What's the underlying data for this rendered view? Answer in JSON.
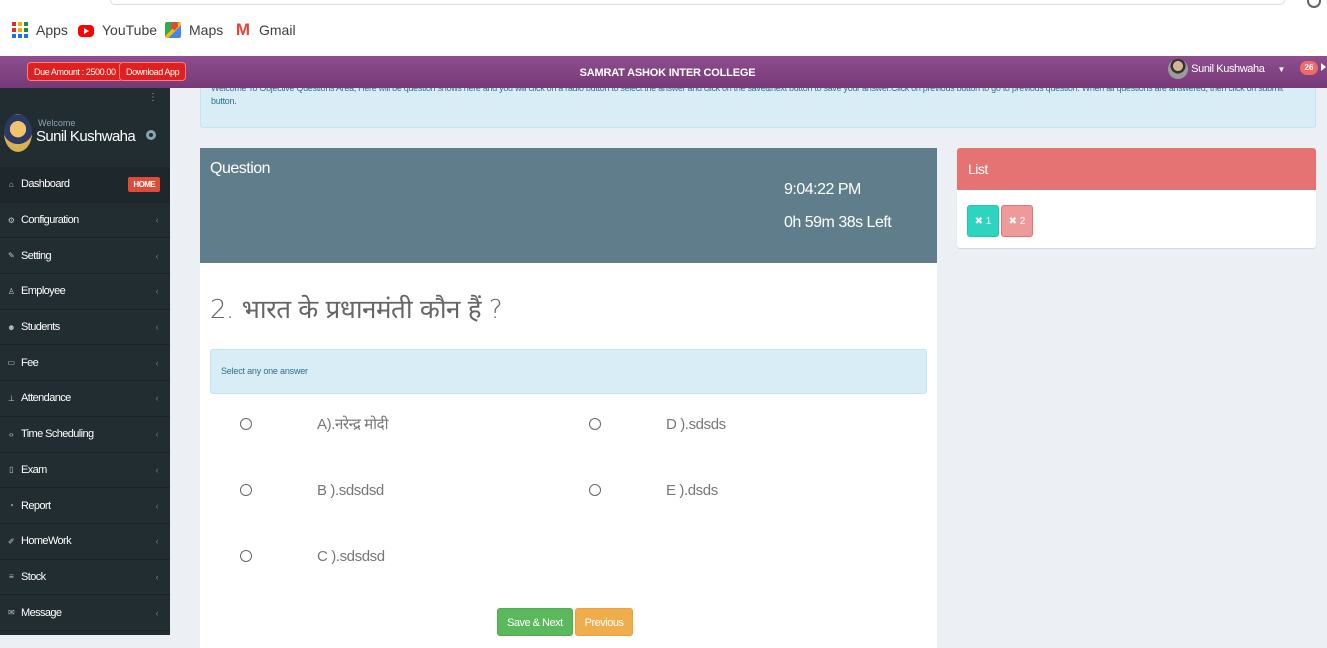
{
  "bookmarks": [
    {
      "label": "Apps",
      "icon": "apps-grid-icon"
    },
    {
      "label": "YouTube",
      "icon": "youtube-icon"
    },
    {
      "label": "Maps",
      "icon": "maps-icon"
    },
    {
      "label": "Gmail",
      "icon": "gmail-icon"
    }
  ],
  "header": {
    "due_amount": "Due Amount : 2500.00",
    "download_app": "Download App",
    "college_name": "SAMRAT ASHOK INTER COLLEGE",
    "user_name": "Sunil Kushwaha",
    "notification_count": "26",
    "brand_color": "#7d417e"
  },
  "sidebar": {
    "welcome": "Welcome",
    "user_name": "Sunil Kushwaha",
    "home_badge": "HOME",
    "items": [
      {
        "label": "Dashboard",
        "icon": "home-icon"
      },
      {
        "label": "Configuration",
        "icon": "cogs-icon"
      },
      {
        "label": "Setting",
        "icon": "wrench-icon"
      },
      {
        "label": "Employee",
        "icon": "user-icon"
      },
      {
        "label": "Students",
        "icon": "users-icon"
      },
      {
        "label": "Fee",
        "icon": "money-icon"
      },
      {
        "label": "Attendance",
        "icon": "sitemap-icon"
      },
      {
        "label": "Time Scheduling",
        "icon": "code-icon"
      },
      {
        "label": "Exam",
        "icon": "file-icon"
      },
      {
        "label": "Report",
        "icon": "report-icon"
      },
      {
        "label": "HomeWork",
        "icon": "pencil-icon"
      },
      {
        "label": "Stock",
        "icon": "list-icon"
      },
      {
        "label": "Message",
        "icon": "envelope-icon"
      }
    ]
  },
  "notice": {
    "text": "Welcome To Objective Questions Area, Here will be question shows here and you will click on a radio button to select the answer and click on the save&next button to save your answer.Click on previous button to go to previous question. When all questions are answered, then click on submit button."
  },
  "question_panel": {
    "title": "Question",
    "clock": "9:04:22 PM",
    "time_left": "0h 59m 38s Left",
    "question_text": "2.  भारत के प्रधानमंती कौन हैं ?",
    "hint": "Select any one answer",
    "options": [
      {
        "label": "A).नरेन्द्र मोदी"
      },
      {
        "label": "B ).sdsdsd"
      },
      {
        "label": "C ).sdsdsd"
      },
      {
        "label": "D ).sdsds"
      },
      {
        "label": "E ).dsds"
      }
    ],
    "save_next_label": "Save & Next",
    "previous_label": "Previous",
    "header_color": "#607d8b"
  },
  "list_panel": {
    "title": "List",
    "items": [
      {
        "label": "✖ 1",
        "status": "answered",
        "color": "#2dd4bf"
      },
      {
        "label": "✖ 2",
        "status": "pending",
        "color": "#ef9a9a"
      }
    ],
    "header_color": "#e57373"
  }
}
